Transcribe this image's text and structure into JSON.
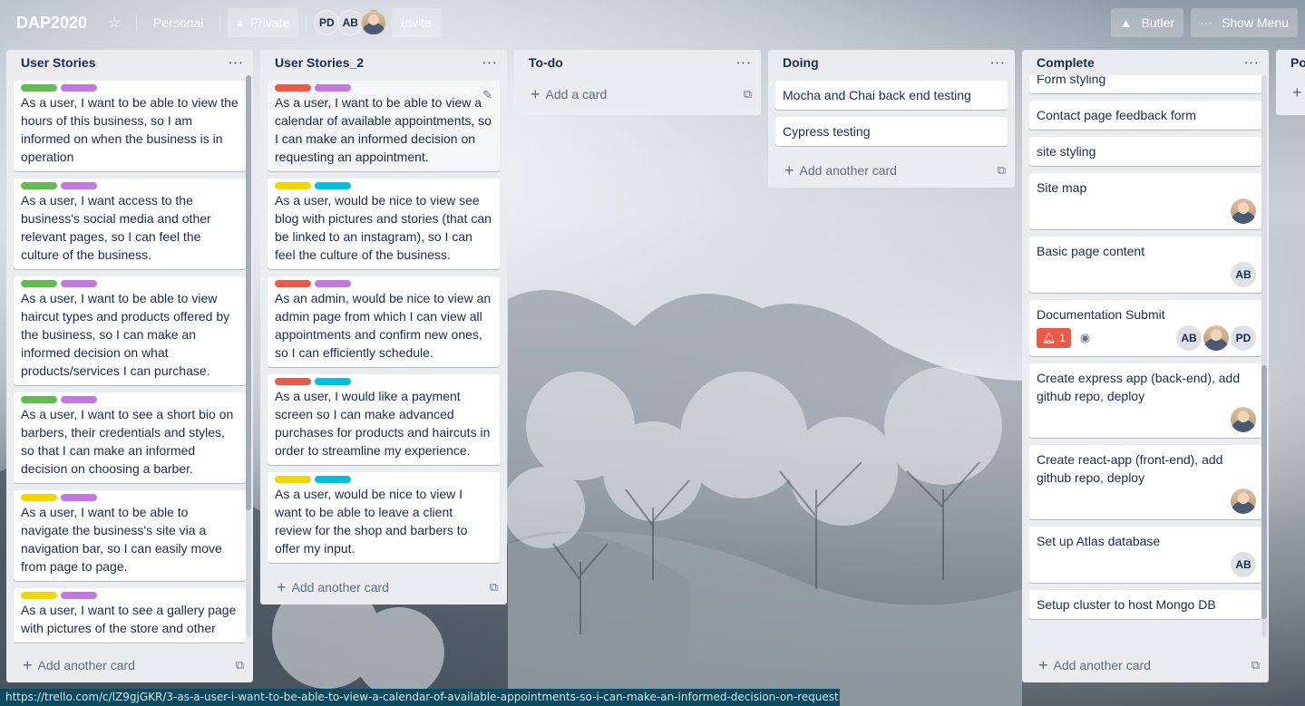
{
  "header": {
    "board_title": "DAP2020",
    "workspace": "Personal",
    "visibility": "Private",
    "members": [
      "PD",
      "AB"
    ],
    "invite_label": "Invite",
    "butler_label": "Butler",
    "show_menu_label": "Show Menu"
  },
  "colors": {
    "green": "#61bd4f",
    "purple": "#c377e0",
    "red": "#eb5a46",
    "yellow": "#f2d600",
    "sky": "#00c2e0"
  },
  "lists": [
    {
      "title": "User Stories",
      "add_label": "Add another card",
      "cards": [
        {
          "labels": [
            "green",
            "purple"
          ],
          "text": "As a user, I want to be able to view the hours of this business, so I am informed on when the business is in operation"
        },
        {
          "labels": [
            "green",
            "purple"
          ],
          "text": "As a user, I want access to the business's social media and other relevant pages, so I can feel the culture of the business."
        },
        {
          "labels": [
            "green",
            "purple"
          ],
          "text": "As a user, I want to be able to view haircut types and products offered by the business, so I can make an informed decision on what products/services I can purchase."
        },
        {
          "labels": [
            "green",
            "purple"
          ],
          "text": "As a user, I want to see a short bio on barbers, their credentials and styles, so that I can make an informed decision on choosing a barber."
        },
        {
          "labels": [
            "yellow",
            "purple"
          ],
          "text": "As a user, I want to be able to navigate the business's site via a navigation bar, so I can easily move from page to page."
        },
        {
          "labels": [
            "yellow",
            "purple"
          ],
          "text": "As a user, I want to see a gallery page with pictures of the store and other"
        }
      ]
    },
    {
      "title": "User Stories_2",
      "add_label": "Add another card",
      "cards": [
        {
          "labels": [
            "red",
            "purple"
          ],
          "text": "As a user, I want to be able to view a calendar of available appointments, so I can make an informed decision on requesting an appointment."
        },
        {
          "labels": [
            "yellow",
            "sky"
          ],
          "text": "As a user, would be nice to view see blog with pictures and stories (that can be linked to an instagram), so I can feel the culture of the business."
        },
        {
          "labels": [
            "red",
            "purple"
          ],
          "text": "As an admin, would be nice to view an admin page from which I can view all appointments and confirm new ones, so I can efficiently schedule."
        },
        {
          "labels": [
            "red",
            "sky"
          ],
          "text": "As a user, I would like a payment screen so I can make advanced purchases for products and haircuts in order to streamline my experience."
        },
        {
          "labels": [
            "yellow",
            "sky"
          ],
          "text": "As a user, would be nice to view I want to be able to leave a client review for the shop and barbers to offer my input."
        }
      ]
    },
    {
      "title": "To-do",
      "add_label": "Add a card",
      "cards": []
    },
    {
      "title": "Doing",
      "add_label": "Add another card",
      "cards": [
        {
          "text": "Mocha and Chai back end testing"
        },
        {
          "text": "Cypress testing"
        }
      ]
    },
    {
      "title": "Complete",
      "add_label": "Add another card",
      "cards": [
        {
          "text": "Form styling"
        },
        {
          "text": "Contact page feedback form"
        },
        {
          "text": "site styling"
        },
        {
          "text": "Site map",
          "members": [
            "photo"
          ]
        },
        {
          "text": "Basic page content",
          "members": [
            "AB"
          ]
        },
        {
          "text": "Documentation Submit",
          "notifications": "1",
          "watching": true,
          "members": [
            "AB",
            "photo",
            "PD"
          ]
        },
        {
          "text": "Create express app (back-end), add github repo, deploy",
          "members": [
            "photo"
          ]
        },
        {
          "text": "Create react-app (front-end), add github repo, deploy",
          "members": [
            "photo"
          ]
        },
        {
          "text": "Set up Atlas database",
          "members": [
            "AB"
          ]
        },
        {
          "text": "Setup cluster to host Mongo DB"
        }
      ]
    },
    {
      "title": "Po",
      "add_label": "",
      "cards": []
    }
  ],
  "status_url": "https://trello.com/c/lZ9gjGKR/3-as-a-user-i-want-to-be-able-to-view-a-calendar-of-available-appointments-so-i-can-make-an-informed-decision-on-requesting-an-app"
}
